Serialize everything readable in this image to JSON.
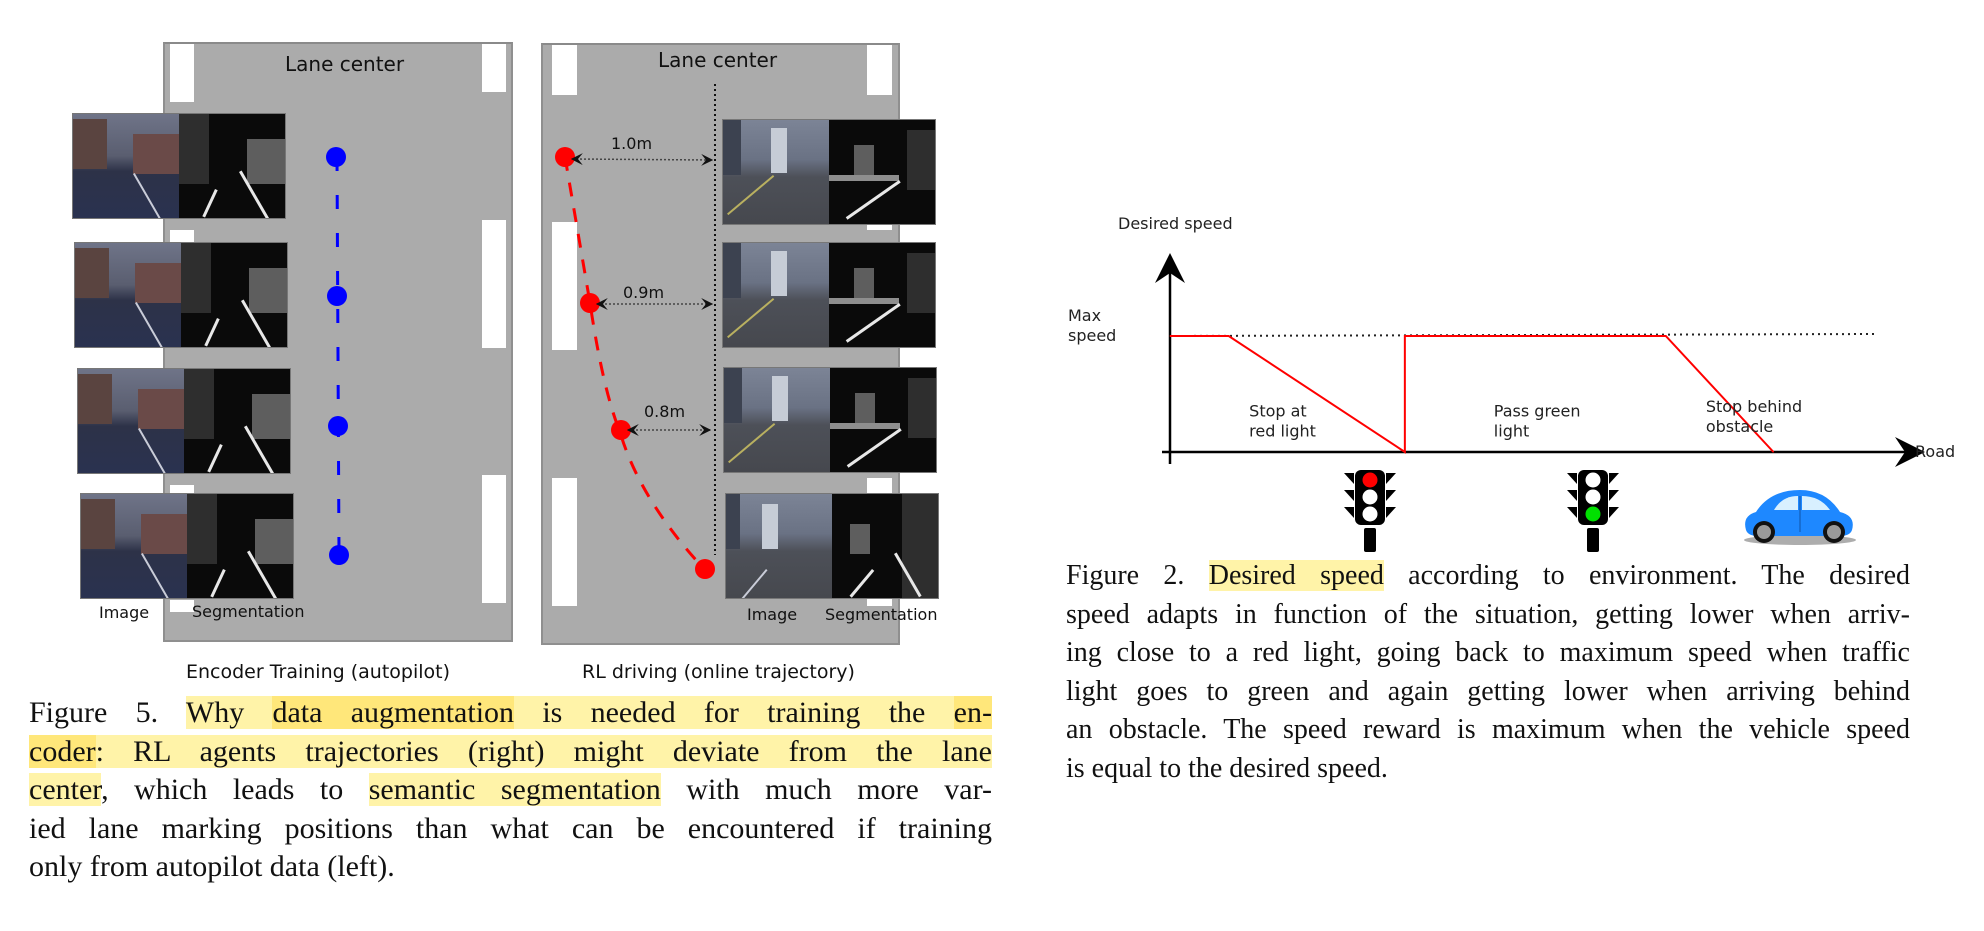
{
  "figure5": {
    "left_panel": {
      "title": "Lane center",
      "subtitle": "Encoder Training (autopilot)",
      "image_label": "Image",
      "segmentation_label": "Segmentation",
      "trajectory_color": "#0000ff",
      "point_count": 4
    },
    "right_panel": {
      "title": "Lane center",
      "subtitle": "RL driving (online trajectory)",
      "image_label": "Image",
      "segmentation_label": "Segmentation",
      "trajectory_color": "#ff0000",
      "distances": [
        "1.0m",
        "0.9m",
        "0.8m"
      ]
    },
    "caption_lines": [
      [
        {
          "t": "Figure 5. ",
          "h": 0
        },
        {
          "t": "Why ",
          "h": 1
        },
        {
          "t": "data augmentation",
          "h": 2
        },
        {
          "t": " is needed for training the ",
          "h": 1
        },
        {
          "t": "en-",
          "h": 2
        }
      ],
      [
        {
          "t": "coder",
          "h": 2
        },
        {
          "t": ": RL agents trajectories (right) might deviate from the lane",
          "h": 1
        }
      ],
      [
        {
          "t": "center",
          "h": 1
        },
        {
          "t": ", which leads to ",
          "h": 0
        },
        {
          "t": "semantic segmentation",
          "h": 1
        },
        {
          "t": " with much more var-",
          "h": 0
        }
      ],
      [
        {
          "t": "ied lane marking positions than what can be encountered if training",
          "h": 0
        }
      ],
      [
        {
          "t": "only from autopilot data (left).",
          "h": 0
        }
      ]
    ]
  },
  "figure2": {
    "caption_lines": [
      [
        {
          "t": "Figure 2. ",
          "h": 0
        },
        {
          "t": "Desired speed",
          "h": 1
        },
        {
          "t": " according to environment.  The desired",
          "h": 0
        }
      ],
      [
        {
          "t": "speed adapts in function of the situation, getting lower when arriv-",
          "h": 0
        }
      ],
      [
        {
          "t": "ing close to a red light, going back to maximum speed when traffic",
          "h": 0
        }
      ],
      [
        {
          "t": "light goes to green and again getting lower when arriving behind",
          "h": 0
        }
      ],
      [
        {
          "t": "an obstacle. The speed reward is maximum when the vehicle speed",
          "h": 0
        }
      ],
      [
        {
          "t": "is equal to the desired speed.",
          "h": 0
        }
      ]
    ],
    "icons": [
      "traffic-light-red-icon",
      "traffic-light-green-icon",
      "car-icon"
    ]
  },
  "chart_data": {
    "type": "line",
    "title": "",
    "xlabel": "Road",
    "ylabel": "Desired speed",
    "reference_line": {
      "label": "Max speed",
      "y": 1.0,
      "style": "dotted"
    },
    "x": [
      0,
      0.18,
      0.72,
      0.72,
      1.52,
      1.85
    ],
    "series": [
      {
        "name": "Desired speed",
        "color": "#ff0000",
        "values": [
          1.0,
          1.0,
          0.0,
          1.0,
          1.0,
          0.0
        ]
      }
    ],
    "xlim": [
      0,
      2.1
    ],
    "ylim": [
      0,
      1.35
    ],
    "annotations": [
      {
        "text": "Stop at\nred light",
        "x": 0.35,
        "y": 0.22
      },
      {
        "text": "Pass green\nlight",
        "x": 1.1,
        "y": 0.22
      },
      {
        "text": "Stop behind\nobstacle",
        "x": 1.75,
        "y": 0.26
      }
    ],
    "grid": false,
    "legend": "none"
  }
}
